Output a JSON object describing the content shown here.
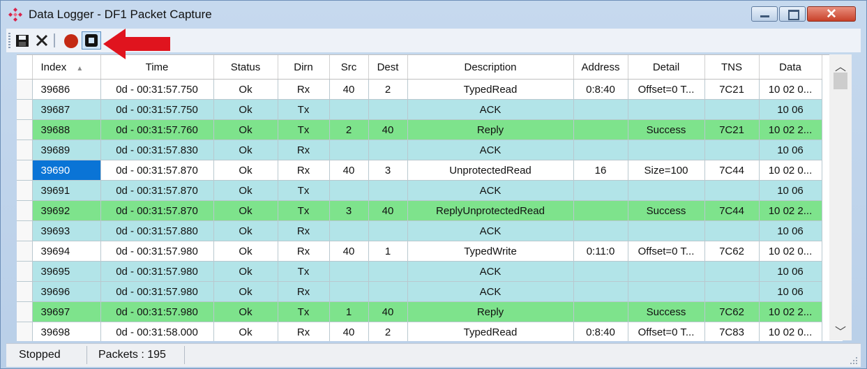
{
  "window": {
    "title": "Data Logger - DF1 Packet Capture"
  },
  "colors": {
    "row_white": "#ffffff",
    "row_cyan": "#b2e4e8",
    "row_green": "#7ee38c",
    "selected": "#0a74d6",
    "annotation_arrow": "#e0141e"
  },
  "toolbar": {
    "icons": [
      "save-icon",
      "clear-icon",
      "record-icon",
      "stop-icon"
    ]
  },
  "columns": [
    "Index",
    "Time",
    "Status",
    "Dirn",
    "Src",
    "Dest",
    "Description",
    "Address",
    "Detail",
    "TNS",
    "Data"
  ],
  "rows": [
    {
      "style": "white",
      "cells": [
        "39686",
        "0d - 00:31:57.750",
        "Ok",
        "Rx",
        "40",
        "2",
        "TypedRead",
        "0:8:40",
        "Offset=0 T...",
        "7C21",
        "10 02 0..."
      ]
    },
    {
      "style": "cyan",
      "cells": [
        "39687",
        "0d - 00:31:57.750",
        "Ok",
        "Tx",
        "",
        "",
        "ACK",
        "",
        "",
        "",
        "10 06"
      ]
    },
    {
      "style": "green",
      "cells": [
        "39688",
        "0d - 00:31:57.760",
        "Ok",
        "Tx",
        "2",
        "40",
        "Reply",
        "",
        "Success",
        "7C21",
        "10 02 2..."
      ]
    },
    {
      "style": "cyan",
      "cells": [
        "39689",
        "0d - 00:31:57.830",
        "Ok",
        "Rx",
        "",
        "",
        "ACK",
        "",
        "",
        "",
        "10 06"
      ]
    },
    {
      "style": "white",
      "selected": true,
      "cells": [
        "39690",
        "0d - 00:31:57.870",
        "Ok",
        "Rx",
        "40",
        "3",
        "UnprotectedRead",
        "16",
        "Size=100",
        "7C44",
        "10 02 0..."
      ]
    },
    {
      "style": "cyan",
      "cells": [
        "39691",
        "0d - 00:31:57.870",
        "Ok",
        "Tx",
        "",
        "",
        "ACK",
        "",
        "",
        "",
        "10 06"
      ]
    },
    {
      "style": "green",
      "cells": [
        "39692",
        "0d - 00:31:57.870",
        "Ok",
        "Tx",
        "3",
        "40",
        "ReplyUnprotectedRead",
        "",
        "Success",
        "7C44",
        "10 02 2..."
      ]
    },
    {
      "style": "cyan",
      "cells": [
        "39693",
        "0d - 00:31:57.880",
        "Ok",
        "Rx",
        "",
        "",
        "ACK",
        "",
        "",
        "",
        "10 06"
      ]
    },
    {
      "style": "white",
      "cells": [
        "39694",
        "0d - 00:31:57.980",
        "Ok",
        "Rx",
        "40",
        "1",
        "TypedWrite",
        "0:11:0",
        "Offset=0 T...",
        "7C62",
        "10 02 0..."
      ]
    },
    {
      "style": "cyan",
      "cells": [
        "39695",
        "0d - 00:31:57.980",
        "Ok",
        "Tx",
        "",
        "",
        "ACK",
        "",
        "",
        "",
        "10 06"
      ]
    },
    {
      "style": "cyan",
      "cells": [
        "39696",
        "0d - 00:31:57.980",
        "Ok",
        "Rx",
        "",
        "",
        "ACK",
        "",
        "",
        "",
        "10 06"
      ]
    },
    {
      "style": "green",
      "cells": [
        "39697",
        "0d - 00:31:57.980",
        "Ok",
        "Tx",
        "1",
        "40",
        "Reply",
        "",
        "Success",
        "7C62",
        "10 02 2..."
      ]
    },
    {
      "style": "white",
      "cells": [
        "39698",
        "0d - 00:31:58.000",
        "Ok",
        "Rx",
        "40",
        "2",
        "TypedRead",
        "0:8:40",
        "Offset=0 T...",
        "7C83",
        "10 02 0..."
      ]
    }
  ],
  "statusbar": {
    "state": "Stopped",
    "packets": "Packets : 195"
  },
  "sort": {
    "column": "Index",
    "direction": "ascending"
  }
}
